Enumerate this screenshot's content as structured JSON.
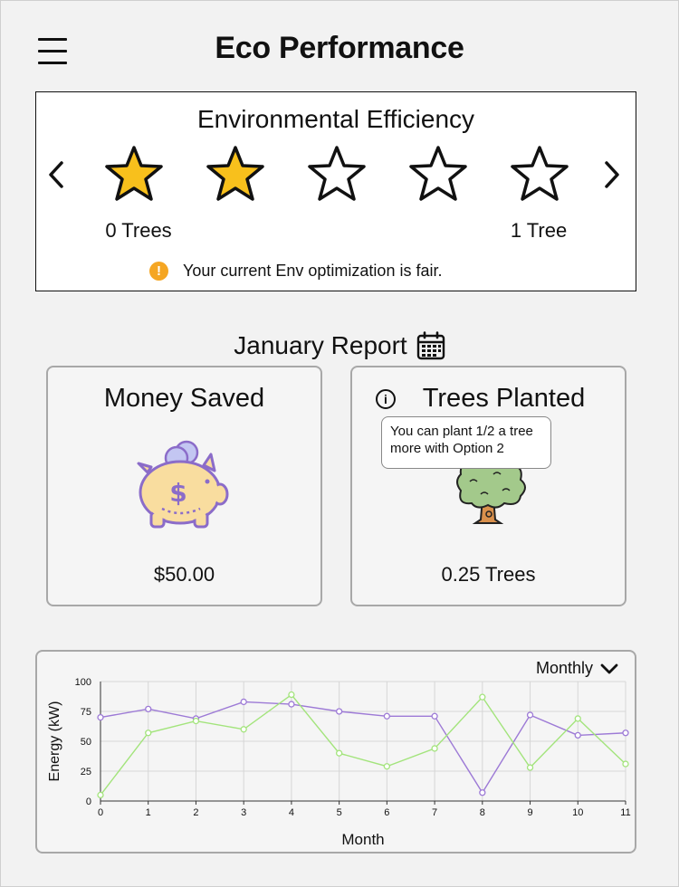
{
  "header": {
    "title": "Eco Performance",
    "menu_icon": "hamburger-menu-icon"
  },
  "efficiency": {
    "title": "Environmental Efficiency",
    "rating": 2,
    "max_rating": 5,
    "left_label": "0 Trees",
    "right_label": "1 Tree",
    "status": "Your current Env optimization is fair.",
    "status_icon": "warning-icon",
    "colors": {
      "star_filled": "#f8c01c",
      "warning": "#f5a623"
    }
  },
  "report": {
    "title": "January Report",
    "calendar_icon": "calendar-icon",
    "money": {
      "title": "Money Saved",
      "value": "$50.00",
      "icon": "piggy-bank-icon"
    },
    "trees": {
      "title": "Trees Planted",
      "value": "0.25 Trees",
      "icon": "tree-icon",
      "tooltip_line1": "You can plant 1/2 a tree",
      "tooltip_line2": "more with Option 2"
    }
  },
  "chart_panel": {
    "period": "Monthly"
  },
  "chart_data": {
    "type": "line",
    "xlabel": "Month",
    "ylabel": "Energy (kW)",
    "x": [
      0,
      1,
      2,
      3,
      4,
      5,
      6,
      7,
      8,
      9,
      10,
      11
    ],
    "ylim": [
      0,
      100
    ],
    "yticks": [
      0,
      25,
      50,
      75,
      100
    ],
    "grid": true,
    "series": [
      {
        "color": "#9d7ad6",
        "values": [
          70,
          77,
          69,
          83,
          81,
          75,
          71,
          71,
          7,
          72,
          55,
          57
        ]
      },
      {
        "color": "#a3e47c",
        "values": [
          5,
          57,
          67,
          60,
          89,
          40,
          29,
          44,
          87,
          28,
          69,
          31
        ]
      }
    ]
  }
}
